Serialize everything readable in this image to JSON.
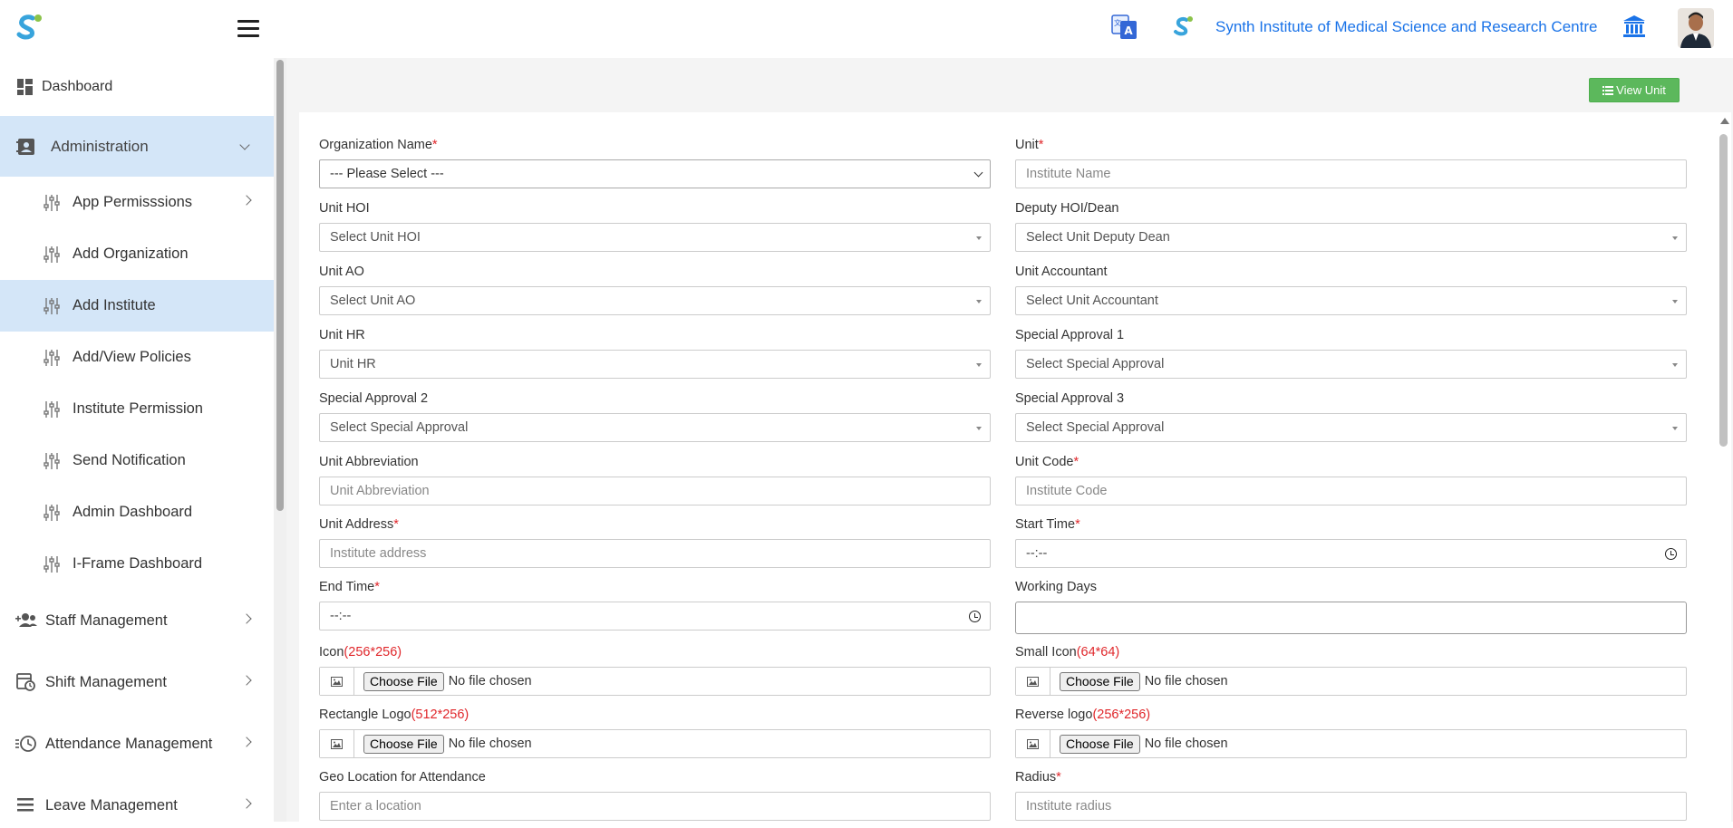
{
  "header": {
    "institute_name": "Synth Institute of Medical Science and Research Centre"
  },
  "sidebar": {
    "dashboard": "Dashboard",
    "administration": "Administration",
    "admin_items": [
      {
        "label": "App Permisssions"
      },
      {
        "label": "Add Organization"
      },
      {
        "label": "Add Institute"
      },
      {
        "label": "Add/View Policies"
      },
      {
        "label": "Institute Permission"
      },
      {
        "label": "Send Notification"
      },
      {
        "label": "Admin Dashboard"
      },
      {
        "label": "I-Frame Dashboard"
      }
    ],
    "groups": [
      {
        "label": "Staff Management"
      },
      {
        "label": "Shift Management"
      },
      {
        "label": "Attendance Management"
      },
      {
        "label": "Leave Management"
      }
    ]
  },
  "toolbar": {
    "view_unit": "View Unit"
  },
  "form": {
    "org_name": {
      "label": "Organization Name",
      "value": "--- Please Select ---"
    },
    "unit": {
      "label": "Unit",
      "placeholder": "Institute Name"
    },
    "unit_hoi": {
      "label": "Unit HOI",
      "value": "Select Unit HOI"
    },
    "deputy_hoi": {
      "label": "Deputy HOI/Dean",
      "value": "Select Unit Deputy Dean"
    },
    "unit_ao": {
      "label": "Unit AO",
      "value": "Select Unit AO"
    },
    "unit_accountant": {
      "label": "Unit Accountant",
      "value": "Select Unit Accountant"
    },
    "unit_hr": {
      "label": "Unit HR",
      "value": "Unit HR"
    },
    "special_1": {
      "label": "Special Approval 1",
      "value": "Select Special Approval"
    },
    "special_2": {
      "label": "Special Approval 2",
      "value": "Select Special Approval"
    },
    "special_3": {
      "label": "Special Approval 3",
      "value": "Select Special Approval"
    },
    "unit_abbr": {
      "label": "Unit Abbreviation",
      "placeholder": "Unit Abbreviation"
    },
    "unit_code": {
      "label": "Unit Code",
      "placeholder": "Institute Code"
    },
    "unit_address": {
      "label": "Unit Address",
      "placeholder": "Institute address"
    },
    "start_time": {
      "label": "Start Time",
      "value": "--:--"
    },
    "end_time": {
      "label": "End Time",
      "value": "--:--"
    },
    "working_days": {
      "label": "Working Days",
      "value": ""
    },
    "icon": {
      "label": "Icon",
      "hint": "(256*256)"
    },
    "small_icon": {
      "label": "Small Icon",
      "hint": "(64*64)"
    },
    "rect_logo": {
      "label": "Rectangle Logo",
      "hint": "(512*256)"
    },
    "reverse_logo": {
      "label": "Reverse logo",
      "hint": "(256*256)"
    },
    "geo": {
      "label": "Geo Location for Attendance",
      "placeholder": "Enter a location"
    },
    "radius": {
      "label": "Radius",
      "placeholder": "Institute radius"
    },
    "required_mark": "*",
    "choose_file": "Choose File",
    "no_file": "No file chosen"
  },
  "colors": {
    "accent": "#1a73e8",
    "sidebar_active": "#d4e6f8",
    "button_green": "#5cb85c",
    "required": "#e0272b"
  }
}
